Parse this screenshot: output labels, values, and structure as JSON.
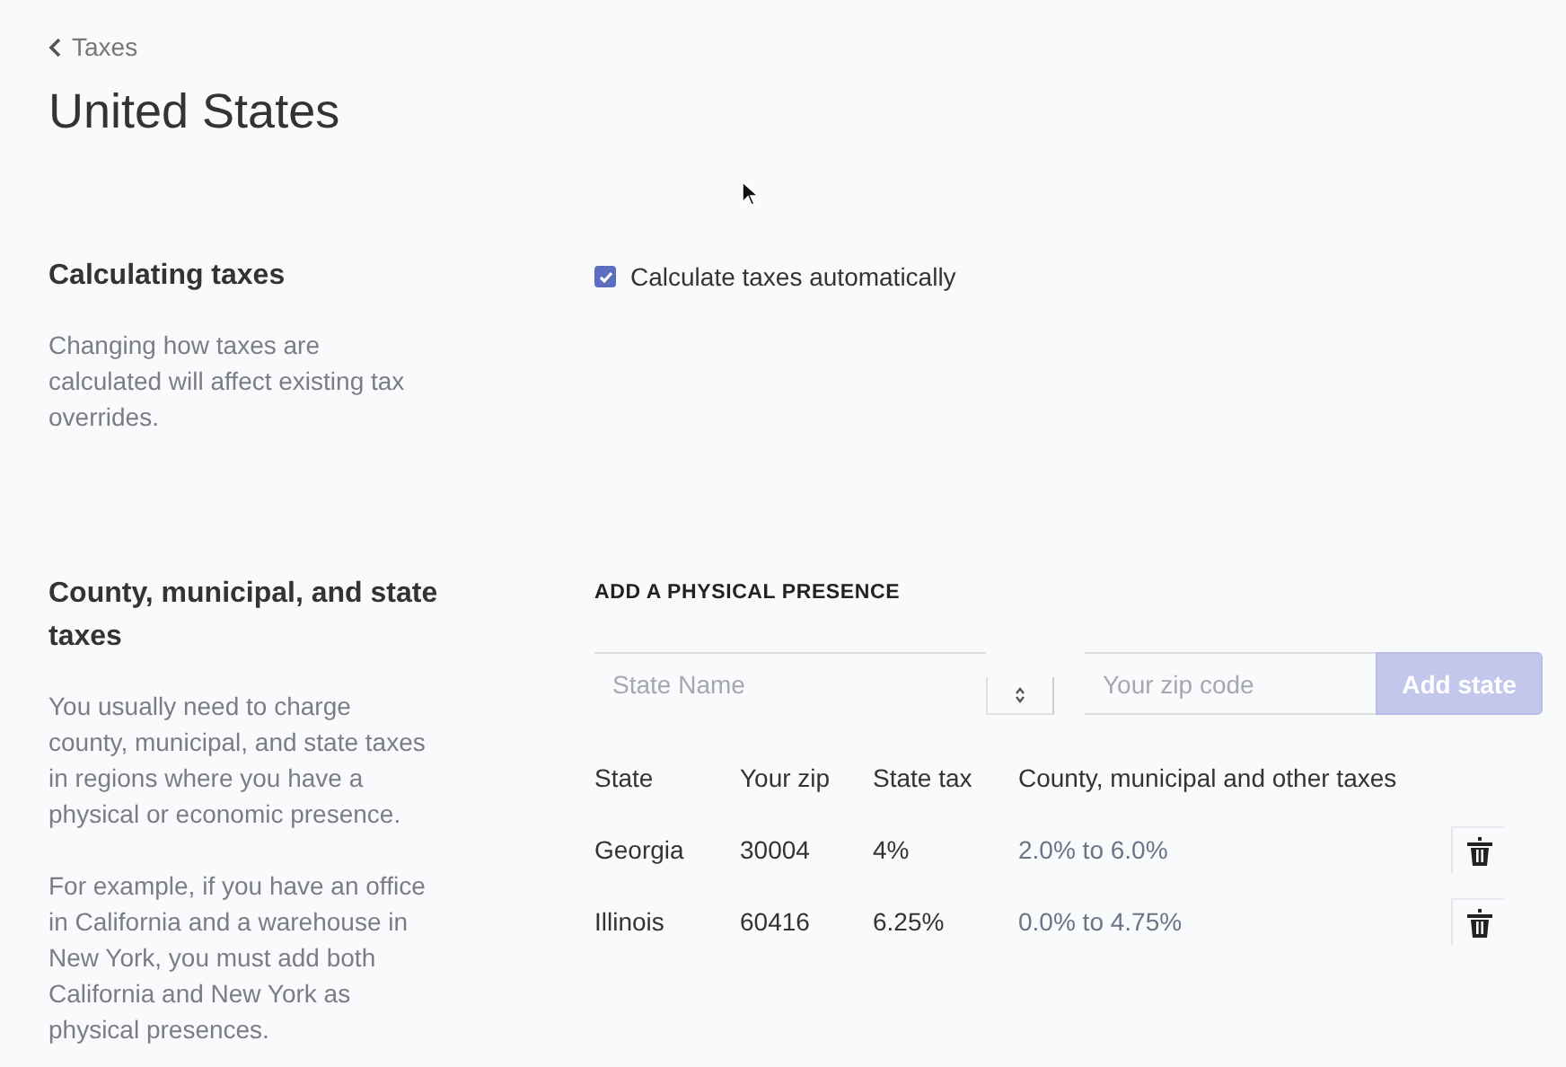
{
  "breadcrumb": {
    "label": "Taxes"
  },
  "title": "United States",
  "sections": [
    {
      "kind": "checkbox",
      "heading": "Calculating taxes",
      "paragraphs": [
        "Changing how taxes are calculated will affect existing tax overrides."
      ],
      "checkbox": {
        "label": "Calculate taxes automatically",
        "checked": true
      }
    },
    {
      "kind": "presence",
      "heading": "County, municipal, and state taxes",
      "paragraphs": [
        "You usually need to charge county, municipal, and state taxes in regions where you have a physical or economic presence.",
        "For example, if you have an office in California and a warehouse in New York, you must add both California and New York as physical presences."
      ],
      "presence": {
        "label": "ADD A PHYSICAL PRESENCE",
        "state_field": {
          "placeholder": "State Name"
        },
        "zip_field": {
          "placeholder": "Your zip code"
        },
        "button": {
          "label": "Add state",
          "disabled": true
        },
        "table": {
          "columns": [
            "State",
            "Your zip",
            "State tax",
            "County, municipal and other taxes"
          ],
          "rows": [
            {
              "state": "Georgia",
              "zip": "30004",
              "state_tax": "4%",
              "other_taxes": "2.0% to 6.0%"
            },
            {
              "state": "Illinois",
              "zip": "60416",
              "state_tax": "6.25%",
              "other_taxes": "0.0% to 4.75%"
            }
          ]
        }
      }
    }
  ]
}
